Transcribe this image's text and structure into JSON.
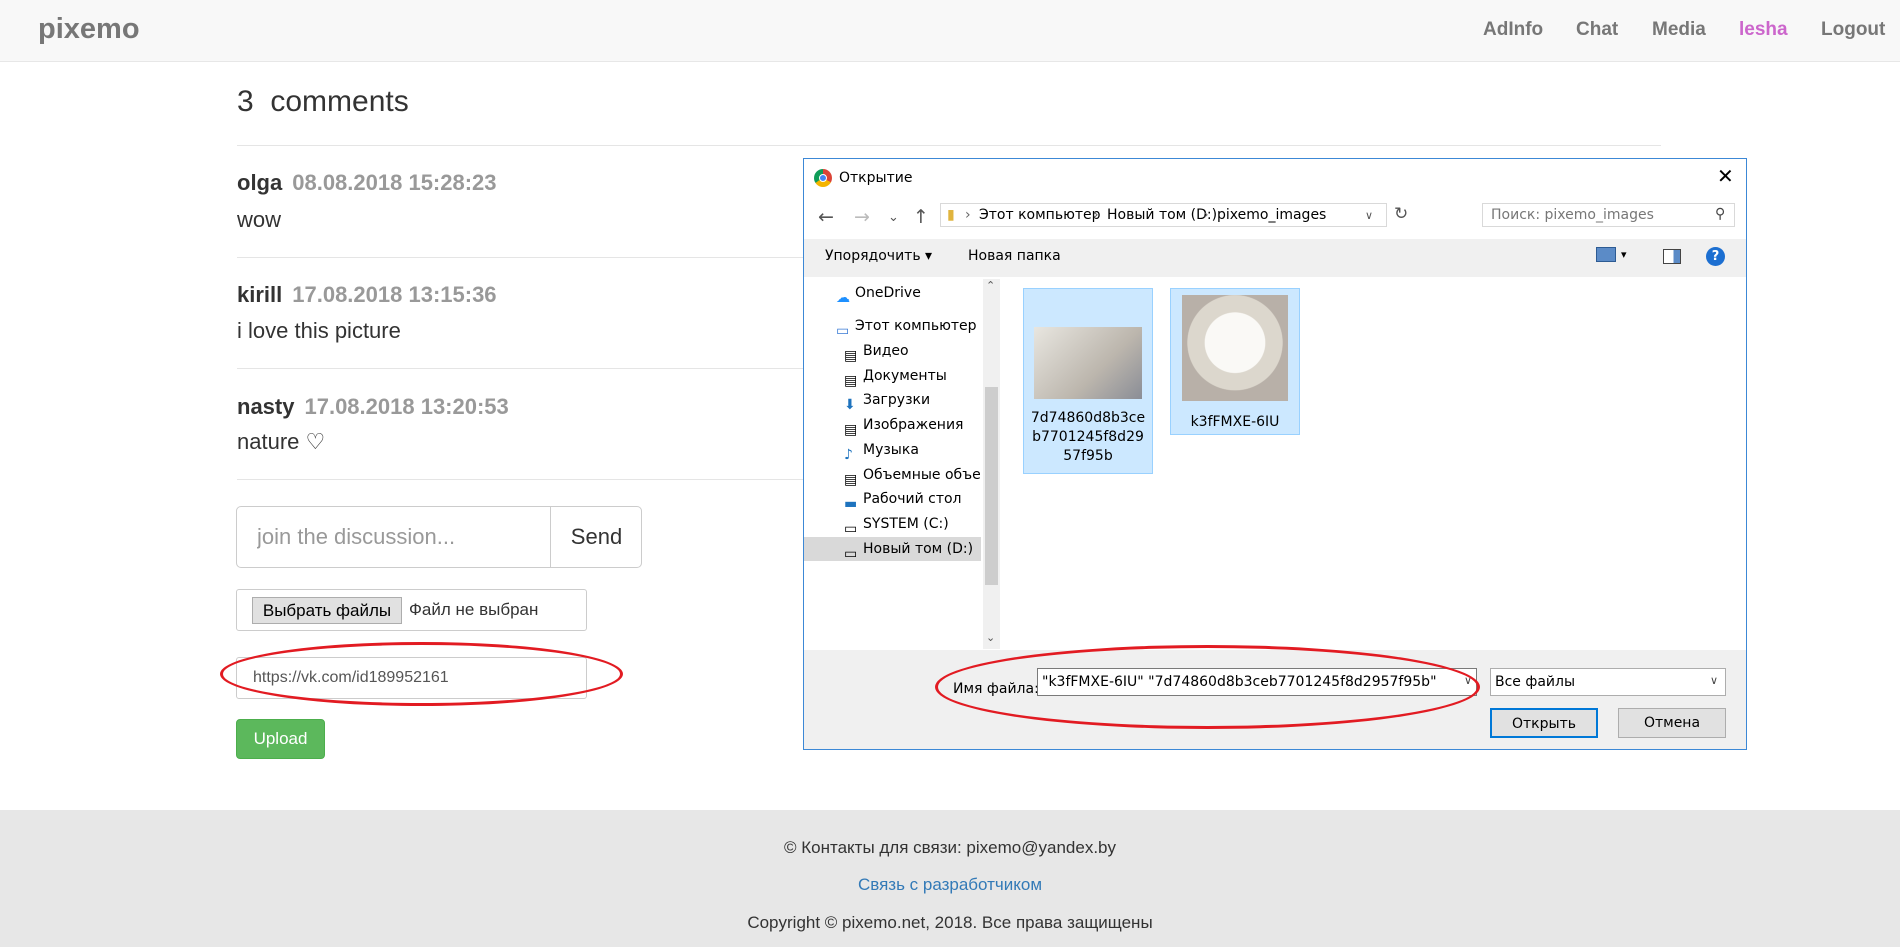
{
  "navbar": {
    "brand": "pixemo",
    "links": [
      "AdInfo",
      "Chat",
      "Media",
      "lesha",
      "Logout"
    ],
    "active_user_color": "#cc66cc"
  },
  "comments": {
    "count": "3",
    "label": "comments",
    "items": [
      {
        "author": "olga",
        "date": "08.08.2018 15:28:23",
        "text": "wow"
      },
      {
        "author": "kirill",
        "date": "17.08.2018 13:15:36",
        "text": "i love this picture"
      },
      {
        "author": "nasty",
        "date": "17.08.2018 13:20:53",
        "text": "nature ♡"
      }
    ]
  },
  "form": {
    "discussion_placeholder": "join the discussion...",
    "send_label": "Send",
    "file_button": "Выбрать файлы",
    "file_status": "Файл не выбран",
    "url_value": "https://vk.com/id189952161",
    "upload_label": "Upload"
  },
  "footer": {
    "contacts": "© Контакты для связи: pixemo@yandex.by",
    "dev_link": "Связь с разработчиком",
    "copyright": "Copyright © pixemo.net, 2018. Все права защищены"
  },
  "dialog": {
    "title": "Открытие",
    "path": [
      "Этот компьютер",
      "Новый том (D:)",
      "pixemo_images"
    ],
    "search_placeholder": "Поиск: pixemo_images",
    "toolbar": {
      "organize": "Упорядочить",
      "new_folder": "Новая папка"
    },
    "tree": [
      "OneDrive",
      "Этот компьютер",
      "Видео",
      "Документы",
      "Загрузки",
      "Изображения",
      "Музыка",
      "Объемные объекты",
      "Рабочий стол",
      "SYSTEM (C:)",
      "Новый том (D:)"
    ],
    "files": [
      {
        "name": "7d74860d8b3ceb7701245f8d2957f95b",
        "icon": "cat-photo-thumbnail"
      },
      {
        "name": "k3fFMXE-6IU",
        "icon": "cat-photo-thumbnail"
      }
    ],
    "filename_label": "Имя файла:",
    "filename_value": "\"k3fFMXE-6IU\" \"7d74860d8b3ceb7701245f8d2957f95b\"",
    "filetype_value": "Все файлы",
    "open_label": "Открыть",
    "cancel_label": "Отмена"
  }
}
